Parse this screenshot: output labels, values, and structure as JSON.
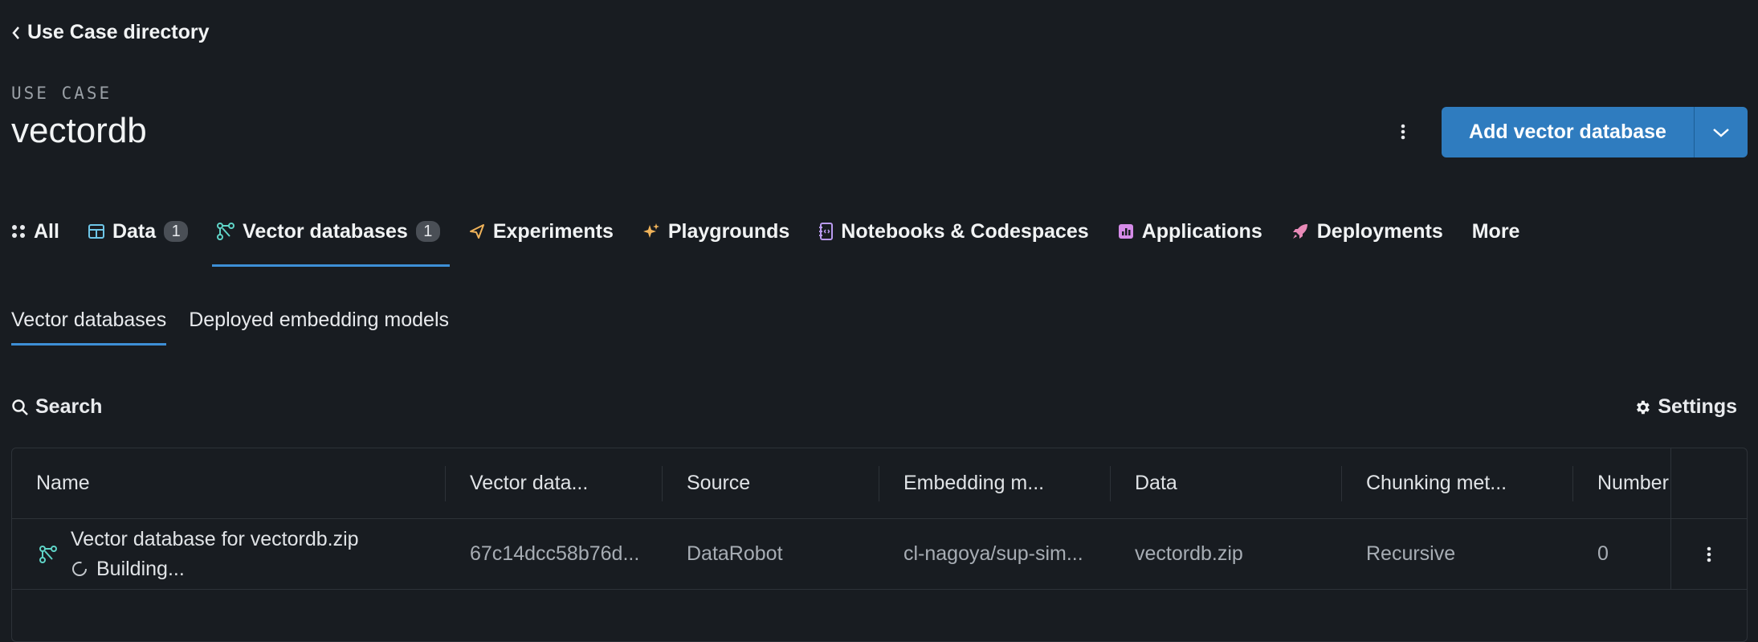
{
  "breadcrumb": {
    "label": "Use Case directory"
  },
  "header": {
    "eyebrow": "USE CASE",
    "title": "vectordb",
    "add_button": "Add vector database"
  },
  "tabs": [
    {
      "label": "All",
      "icon": "grid-dots-icon"
    },
    {
      "label": "Data",
      "badge": "1",
      "icon": "table-icon"
    },
    {
      "label": "Vector databases",
      "badge": "1",
      "icon": "vector-db-icon",
      "active": true
    },
    {
      "label": "Experiments",
      "icon": "paper-plane-icon"
    },
    {
      "label": "Playgrounds",
      "icon": "sparkle-icon"
    },
    {
      "label": "Notebooks & Codespaces",
      "icon": "notebook-icon"
    },
    {
      "label": "Applications",
      "icon": "app-chart-icon"
    },
    {
      "label": "Deployments",
      "icon": "rocket-icon"
    },
    {
      "label": "More"
    }
  ],
  "subtabs": {
    "vector_databases": "Vector databases",
    "deployed_models": "Deployed embedding models"
  },
  "toolbar": {
    "search": "Search",
    "settings": "Settings"
  },
  "table": {
    "columns": [
      "Name",
      "Vector data...",
      "Source",
      "Embedding m...",
      "Data",
      "Chunking met...",
      "Number"
    ],
    "rows": [
      {
        "name": "Vector database for vectordb.zip",
        "status": "Building...",
        "vector_data": "67c14dcc58b76d...",
        "source": "DataRobot",
        "embedding": "cl-nagoya/sup-sim...",
        "data": "vectordb.zip",
        "chunking": "Recursive",
        "number": "0"
      }
    ]
  },
  "colors": {
    "accent": "#3d8fd6",
    "button": "#2f7cbf",
    "background": "#181c21"
  }
}
